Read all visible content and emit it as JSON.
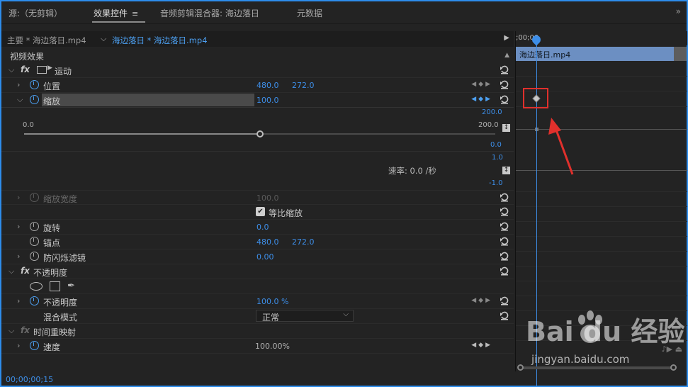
{
  "tabs": [
    {
      "label": "源:（无剪辑）"
    },
    {
      "label": "效果控件",
      "active": true
    },
    {
      "label": "音频剪辑混合器: 海边落日"
    },
    {
      "label": "元数据"
    }
  ],
  "tab_menu_glyph": "≡",
  "clipbar": {
    "master": "主要 * 海边落日.mp4",
    "sequence": "海边落日 * 海边落日.mp4"
  },
  "section_video": "视频效果",
  "motion": {
    "name": "运动",
    "position": {
      "label": "位置",
      "x": "480.0",
      "y": "272.0"
    },
    "scale": {
      "label": "缩放",
      "value": "100.0"
    },
    "graph": {
      "min": "0.0",
      "max": "200.0",
      "slider_fraction": 0.5,
      "rate": "速率: 0.0 /秒",
      "top_max": "200.0",
      "top_min": "0.0",
      "bottom_max": "1.0",
      "bottom_min": "-1.0"
    },
    "scale_width": {
      "label": "缩放宽度",
      "value": "100.0"
    },
    "uniform_scale": {
      "label": "等比缩放",
      "checked": true
    },
    "rotation": {
      "label": "旋转",
      "value": "0.0"
    },
    "anchor": {
      "label": "锚点",
      "x": "480.0",
      "y": "272.0"
    },
    "anti_flicker": {
      "label": "防闪烁滤镜",
      "value": "0.00"
    }
  },
  "opacity": {
    "name": "不透明度",
    "opacity": {
      "label": "不透明度",
      "value": "100.0 %"
    },
    "blend": {
      "label": "混合模式",
      "value": "正常"
    }
  },
  "time_remap": {
    "name": "时间重映射",
    "speed": {
      "label": "速度",
      "value": "100.00%"
    }
  },
  "timecode": "00;00;00;15",
  "timeline": {
    "ruler_time": ";00;00",
    "clip_label": "海边落日.mp4"
  },
  "watermark": {
    "logo": "Bai  du 经验",
    "url": "jingyan.baidu.com"
  },
  "icons": {
    "expand": "chevron-right-icon",
    "collapse": "chevron-down-icon",
    "stopwatch": "stopwatch-icon",
    "reset": "reset-icon",
    "keyframe_nav": "keyframe-nav-icon"
  },
  "colors": {
    "accent": "#3d8ee8",
    "highlight_box": "#e0302c",
    "clip": "#6c8fc2"
  }
}
